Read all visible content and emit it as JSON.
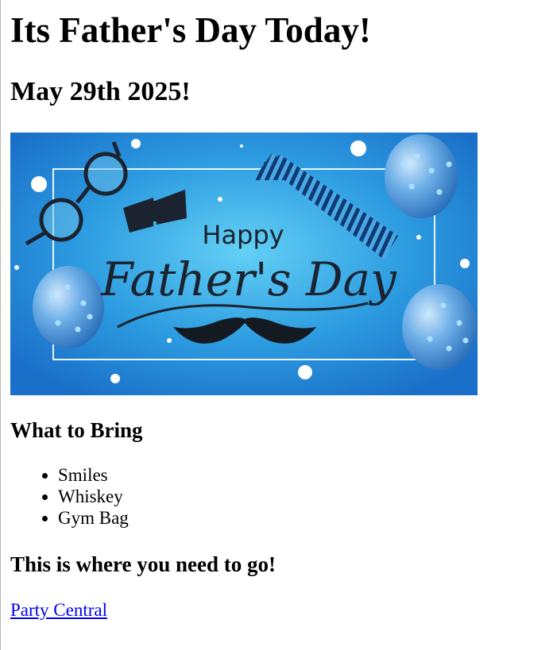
{
  "page": {
    "heading": "Its Father's Day Today!",
    "date": "May 29th 2025!",
    "banner_image": {
      "line1": "Happy",
      "line2": "Father's Day",
      "colors": {
        "bg_light": "#4fc0f0",
        "bg_dark": "#1a74cc",
        "ink": "#1b2330"
      }
    },
    "bring_heading": "What to Bring",
    "bring_items": [
      "Smiles",
      "Whiskey",
      "Gym Bag"
    ],
    "go_heading": "This is where you need to go!",
    "link_text": "Party Central"
  }
}
